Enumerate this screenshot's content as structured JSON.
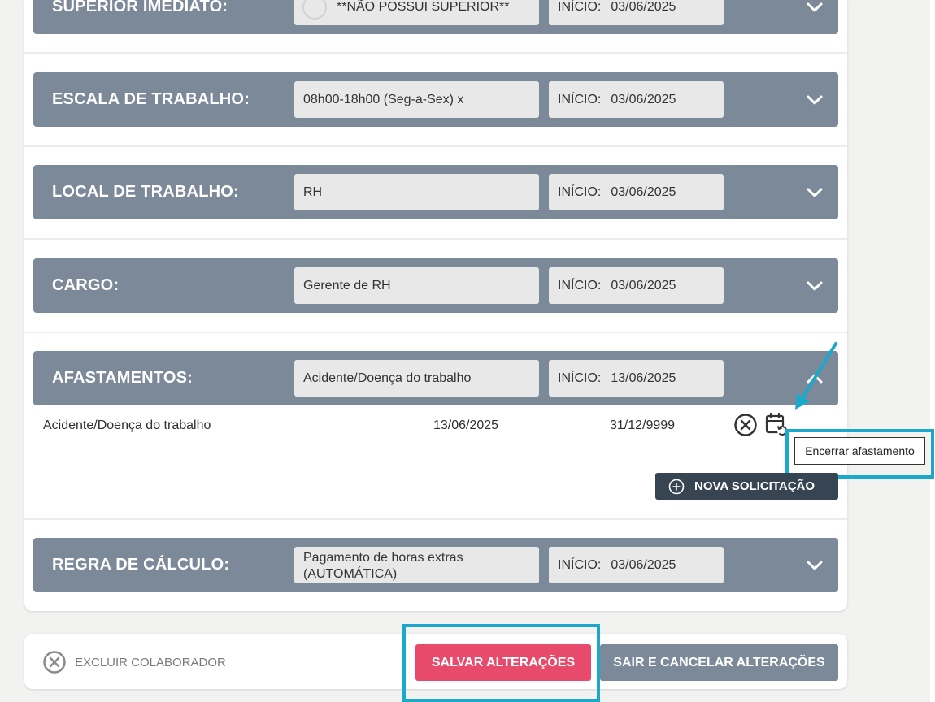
{
  "sections": [
    {
      "label": "SUPERIOR IMEDIATO:",
      "value": "**NÃO POSSUI SUPERIOR**",
      "start_label": "INÍCIO:",
      "start_date": "03/06/2025"
    },
    {
      "label": "ESCALA DE TRABALHO:",
      "value": "08h00-18h00 (Seg-a-Sex) x",
      "start_label": "INÍCIO:",
      "start_date": "03/06/2025"
    },
    {
      "label": "LOCAL DE TRABALHO:",
      "value": "RH",
      "start_label": "INÍCIO:",
      "start_date": "03/06/2025"
    },
    {
      "label": "CARGO:",
      "value": "Gerente de RH",
      "start_label": "INÍCIO:",
      "start_date": "03/06/2025"
    },
    {
      "label": "AFASTAMENTOS:",
      "value": "Acidente/Doença do trabalho",
      "start_label": "INÍCIO:",
      "start_date": "13/06/2025"
    },
    {
      "label": "REGRA DE CÁLCULO:",
      "value_line1": "Pagamento de horas extras",
      "value_line2": "(AUTOMÁTICA)",
      "start_label": "INÍCIO:",
      "start_date": "03/06/2025"
    }
  ],
  "afastamento_row": {
    "type": "Acidente/Doença do trabalho",
    "start": "13/06/2025",
    "end": "31/12/9999"
  },
  "tooltip": "Encerrar afastamento",
  "nova_solicitacao": "NOVA SOLICITAÇÃO",
  "footer": {
    "excluir": "EXCLUIR COLABORADOR",
    "salvar": "SALVAR ALTERAÇÕES",
    "sair": "SAIR E CANCELAR ALTERAÇÕES"
  },
  "colors": {
    "bar": "#7b8998",
    "dark_button": "#374553",
    "save_button": "#e84a6b",
    "highlight": "#1aa9cc"
  }
}
